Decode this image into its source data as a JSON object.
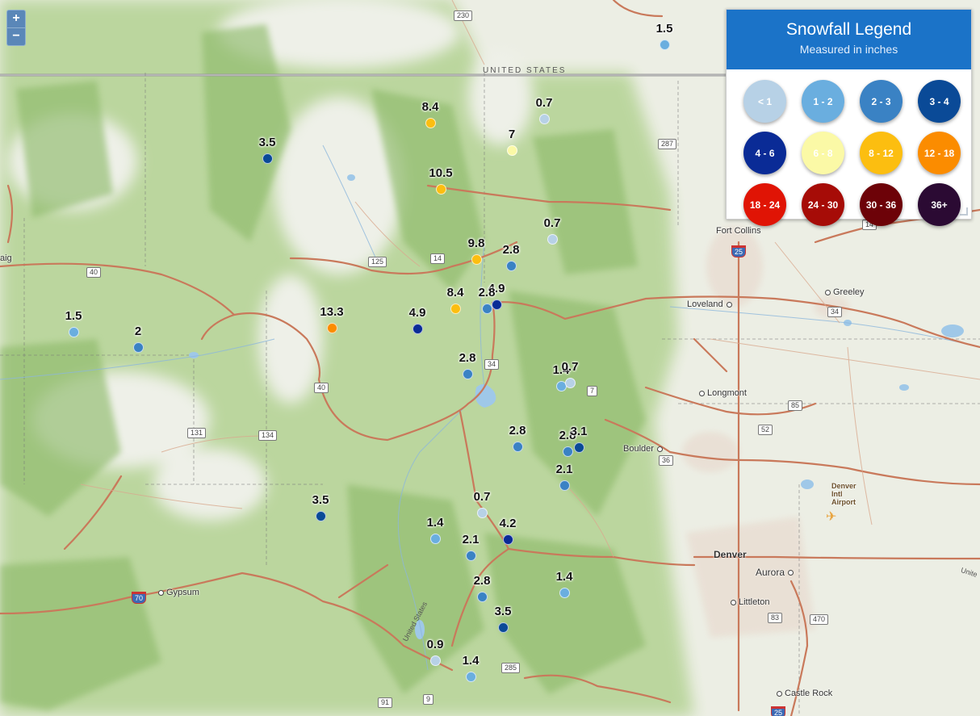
{
  "zoom": {
    "in_label": "+",
    "out_label": "−"
  },
  "legend": {
    "title": "Snowfall Legend",
    "subtitle": "Measured in inches",
    "items": [
      {
        "label": "< 1",
        "color": "#b7d1e6",
        "text": "#ffffff"
      },
      {
        "label": "1 - 2",
        "color": "#6aaedf",
        "text": "#ffffff"
      },
      {
        "label": "2 - 3",
        "color": "#3a82c4",
        "text": "#ffffff"
      },
      {
        "label": "3 - 4",
        "color": "#0a4a97",
        "text": "#ffffff"
      },
      {
        "label": "4 - 6",
        "color": "#0a2b96",
        "text": "#ffffff"
      },
      {
        "label": "6 - 8",
        "color": "#fbf9a6",
        "text": "#ffffff"
      },
      {
        "label": "8 - 12",
        "color": "#fcbe10",
        "text": "#ffffff"
      },
      {
        "label": "12 - 18",
        "color": "#fb8c00",
        "text": "#ffffff"
      },
      {
        "label": "18 - 24",
        "color": "#e01405",
        "text": "#ffffff"
      },
      {
        "label": "24 - 30",
        "color": "#a60c07",
        "text": "#ffffff"
      },
      {
        "label": "30 - 36",
        "color": "#6d0208",
        "text": "#ffffff"
      },
      {
        "label": "36+",
        "color": "#2b0a33",
        "text": "#ffffff"
      }
    ]
  },
  "map": {
    "border_label": "UNITED STATES",
    "cities": [
      "Fort Collins",
      "Greeley",
      "Loveland",
      "Longmont",
      "Boulder",
      "Denver",
      "Aurora",
      "Littleton",
      "Castle Rock",
      "Gypsum",
      "aig"
    ],
    "airport": [
      "Denver",
      "Intl",
      "Airport"
    ],
    "route_shields": [
      "230",
      "287",
      "14",
      "25",
      "34",
      "40",
      "125",
      "14",
      "34",
      "7",
      "40",
      "85",
      "52",
      "36",
      "131",
      "134",
      "70",
      "83",
      "470",
      "285",
      "91",
      "9",
      "25"
    ],
    "road_label": "United States",
    "east_label": "Unite"
  },
  "markers": [
    {
      "value": "1.5",
      "color": "#6aaedf"
    },
    {
      "value": "8.4",
      "color": "#fcbe10"
    },
    {
      "value": "0.7",
      "color": "#b7d1e6"
    },
    {
      "value": "7",
      "color": "#fbf9a6"
    },
    {
      "value": "3.5",
      "color": "#0a4a97"
    },
    {
      "value": "10.5",
      "color": "#fcbe10"
    },
    {
      "value": "0.7",
      "color": "#b7d1e6"
    },
    {
      "value": "9.8",
      "color": "#fcbe10"
    },
    {
      "value": "2.8",
      "color": "#3a82c4"
    },
    {
      "value": "4.9",
      "color": "#0a2b96"
    },
    {
      "value": "2.8",
      "color": "#3a82c4"
    },
    {
      "value": "8.4",
      "color": "#fcbe10"
    },
    {
      "value": "13.3",
      "color": "#fb8c00"
    },
    {
      "value": "4.9",
      "color": "#0a2b96"
    },
    {
      "value": "1.5",
      "color": "#6aaedf"
    },
    {
      "value": "2",
      "color": "#3a82c4"
    },
    {
      "value": "2.8",
      "color": "#3a82c4"
    },
    {
      "value": "1.4",
      "color": "#6aaedf"
    },
    {
      "value": "0.7",
      "color": "#b7d1e6"
    },
    {
      "value": "2.8",
      "color": "#3a82c4"
    },
    {
      "value": "2.8",
      "color": "#3a82c4"
    },
    {
      "value": "3.1",
      "color": "#0a4a97"
    },
    {
      "value": "2.1",
      "color": "#3a82c4"
    },
    {
      "value": "3.5",
      "color": "#0a4a97"
    },
    {
      "value": "0.7",
      "color": "#b7d1e6"
    },
    {
      "value": "1.4",
      "color": "#6aaedf"
    },
    {
      "value": "4.2",
      "color": "#0a2b96"
    },
    {
      "value": "2.1",
      "color": "#3a82c4"
    },
    {
      "value": "2.8",
      "color": "#3a82c4"
    },
    {
      "value": "1.4",
      "color": "#6aaedf"
    },
    {
      "value": "3.5",
      "color": "#0a4a97"
    },
    {
      "value": "0.9",
      "color": "#b7d1e6"
    },
    {
      "value": "1.4",
      "color": "#6aaedf"
    }
  ]
}
